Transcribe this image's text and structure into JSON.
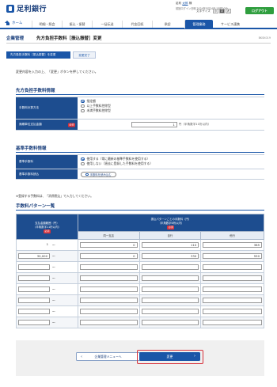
{
  "header": {
    "bank_name": "足利銀行",
    "user_prefix": "足利",
    "user_name": "太郎",
    "user_suffix": "様",
    "last_login": "前回ログイン日時 2024年5月24日 13時20分",
    "font_size_label": "文字サイズ",
    "font_sizes": [
      "小",
      "中",
      "大"
    ],
    "logout_label": "ログアウト"
  },
  "nav": {
    "home": "ホーム",
    "items": [
      "明細・照会",
      "振込・振替",
      "一括伝送",
      "代金回収",
      "承認",
      "管理業務",
      "サービス連携"
    ],
    "active_index": 5
  },
  "page": {
    "category": "企業管理",
    "title": "先方負担手数料［振込振替］変更",
    "screen_id": "BKSK019"
  },
  "steps": [
    "先方負担手数料［振込振替］を変更",
    "変更完了"
  ],
  "instruction": "変更内容を入力の上、「変更」ボタンを押してください。",
  "section1": {
    "title": "先方負担手数料情報",
    "method_label": "手数料計算方法",
    "methods": [
      "指定額",
      "以上手数料控除型",
      "未満手数料控除型"
    ],
    "selected_method": 0,
    "amount_label": "満期単位支払金額",
    "required": "必須",
    "amount_value": "1",
    "amount_unit": "円（半角数字11桁以内）"
  },
  "section2": {
    "title": "基準手数料情報",
    "fee_label": "基準手数料",
    "fee_options": [
      "使用する（常に最新の基準手数料を使用する）",
      "使用しない（過去に登録した手数料を使用する）"
    ],
    "selected_fee": 0,
    "ref_label": "基準手数料読込",
    "ref_button": "手数料を読み込む"
  },
  "note": "※登録する手数料は、「消費税込」で入力してください。",
  "pattern": {
    "title": "手数料パターン一覧",
    "col_amount": "支払金額範囲（円）",
    "col_amount_note": "（半角数字11桁以内）",
    "col_fee": "振込パターンごとの手数料（円）",
    "col_fee_note": "（半角数字6桁以内）",
    "required": "必須",
    "sub_cols": [
      "同一支店",
      "自行",
      "他行"
    ],
    "rows": [
      {
        "from": "1",
        "same": "0",
        "own": "110",
        "other": "385"
      },
      {
        "from": "30,000",
        "same": "0",
        "own": "330",
        "other": "550"
      },
      {
        "from": "",
        "same": "",
        "own": "",
        "other": ""
      },
      {
        "from": "",
        "same": "",
        "own": "",
        "other": ""
      },
      {
        "from": "",
        "same": "",
        "own": "",
        "other": ""
      },
      {
        "from": "",
        "same": "",
        "own": "",
        "other": ""
      },
      {
        "from": "",
        "same": "",
        "own": "",
        "other": ""
      },
      {
        "from": "",
        "same": "",
        "own": "",
        "other": ""
      }
    ],
    "tilde": "～"
  },
  "buttons": {
    "back": "企業管理メニューへ",
    "submit": "変更"
  }
}
